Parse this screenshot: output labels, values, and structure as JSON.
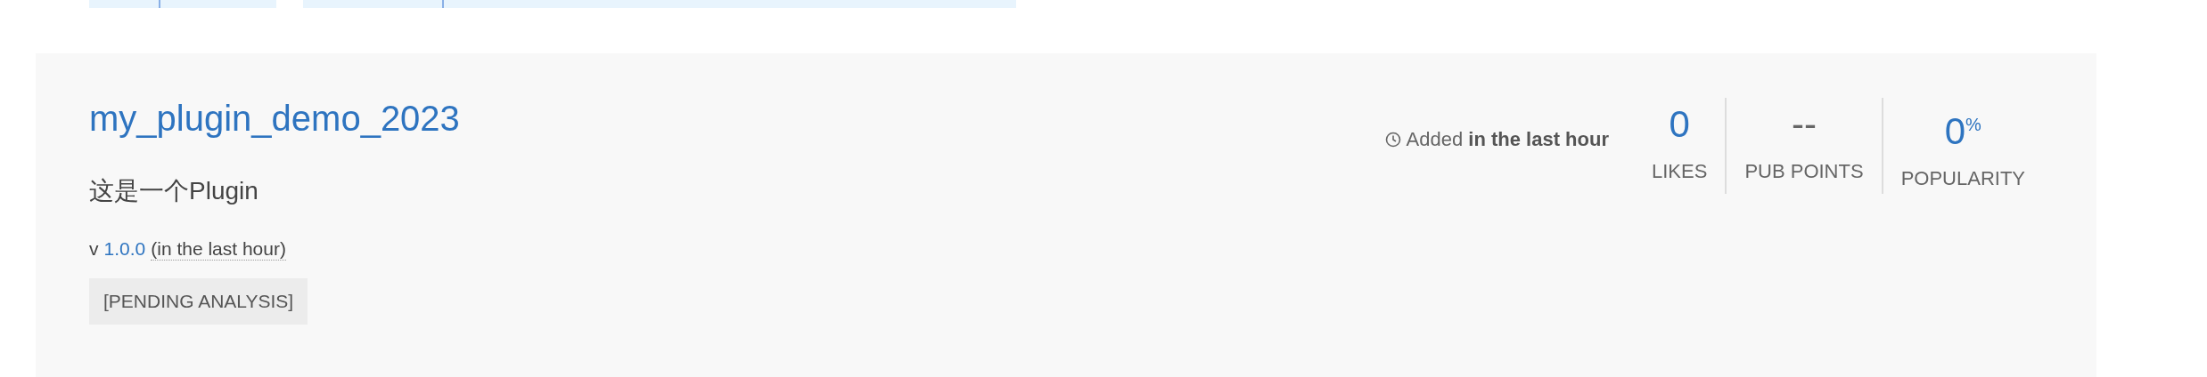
{
  "package": {
    "name": "my_plugin_demo_2023",
    "description": "这是一个Plugin",
    "version_prefix": "v",
    "version": "1.0.0",
    "version_age": "(in the last hour)",
    "tags": [
      "[PENDING ANALYSIS]"
    ],
    "added": "Added **in the last hour**",
    "stats": [
      {
        "value": "0",
        "label": "LIKES",
        "highlighted": true
      },
      {
        "value": "--",
        "label": "PUB POINTS",
        "highlighted": false
      },
      {
        "value": "0$^{%}$",
        "label": "POPULARITY",
        "highlighted": true
      }
    ]
  }
}
